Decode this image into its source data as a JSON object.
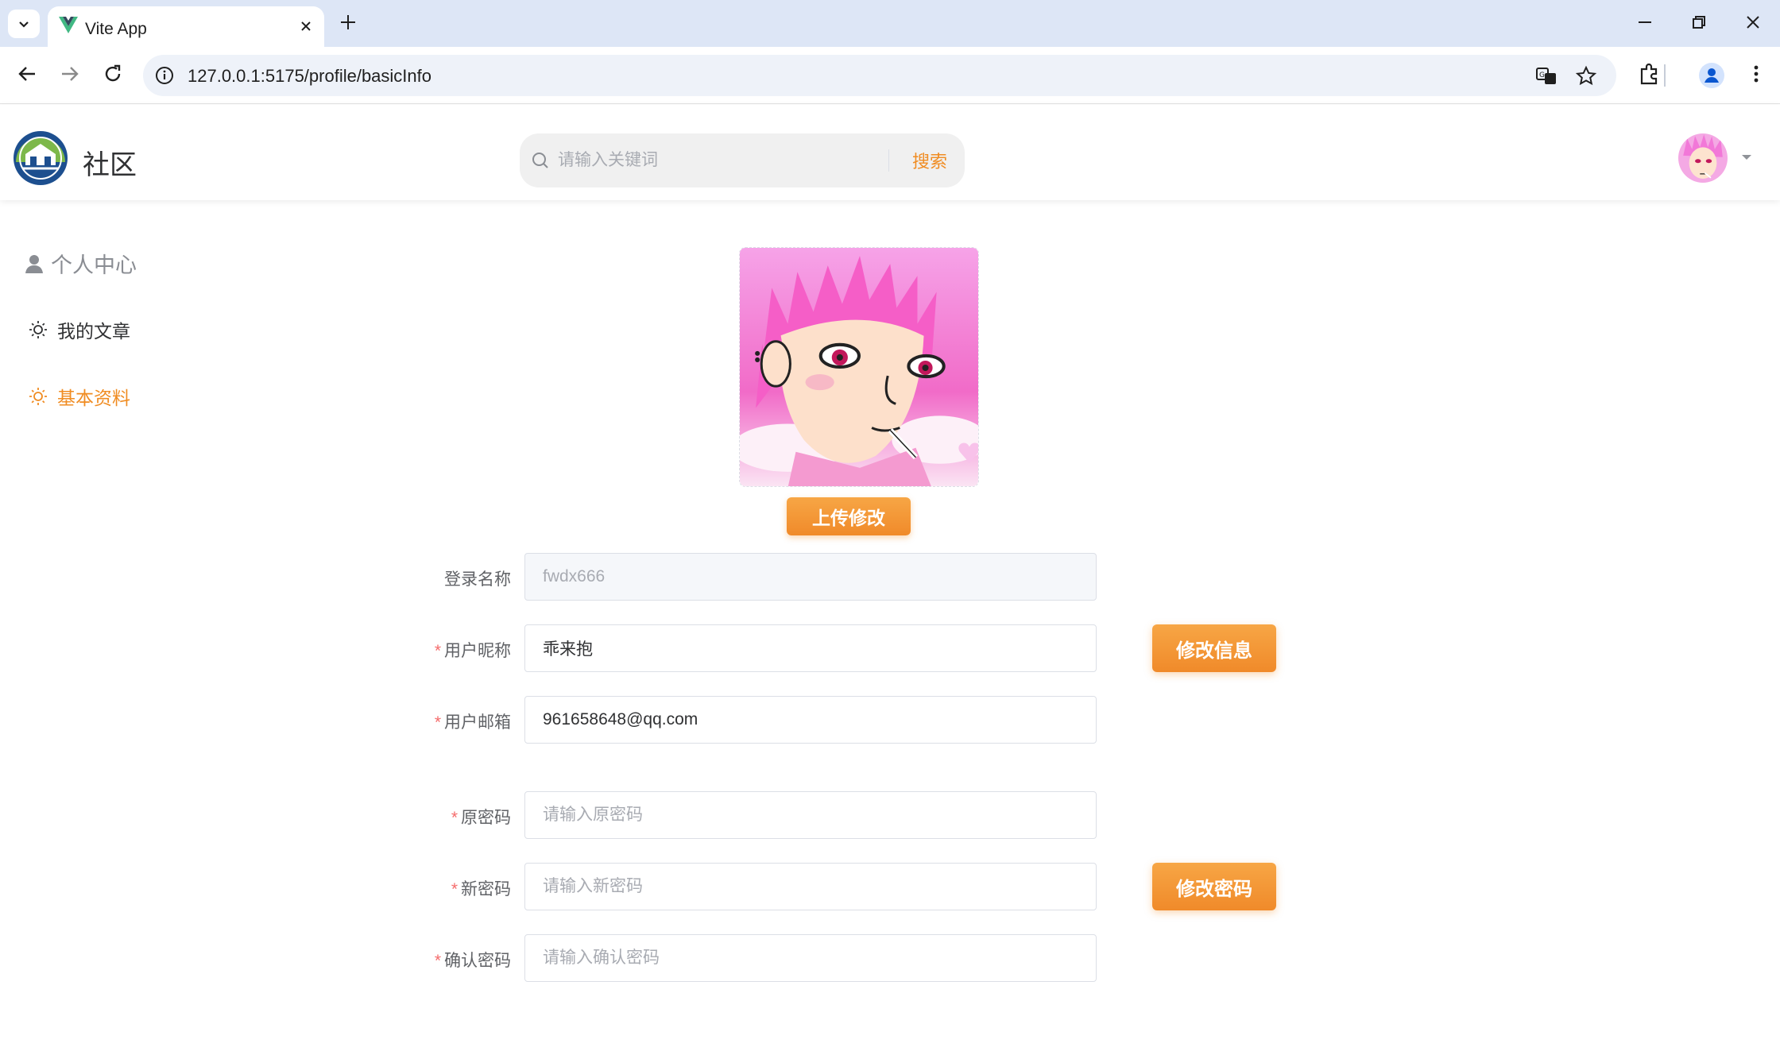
{
  "browser": {
    "tab_title": "Vite App",
    "url": "127.0.0.1:5175/profile/basicInfo"
  },
  "header": {
    "brand": "社区",
    "search_placeholder": "请输入关键词",
    "search_button": "搜索"
  },
  "sidebar": {
    "heading": "个人中心",
    "items": [
      {
        "label": "我的文章",
        "active": false
      },
      {
        "label": "基本资料",
        "active": true
      }
    ]
  },
  "profile": {
    "upload_button": "上传修改",
    "fields": {
      "login_name": {
        "label": "登录名称",
        "value": "fwdx666"
      },
      "nickname": {
        "label": "用户昵称",
        "value": "乖来抱"
      },
      "email": {
        "label": "用户邮箱",
        "value": "961658648@qq.com"
      },
      "old_password": {
        "label": "原密码",
        "placeholder": "请输入原密码"
      },
      "new_password": {
        "label": "新密码",
        "placeholder": "请输入新密码"
      },
      "confirm_password": {
        "label": "确认密码",
        "placeholder": "请输入确认密码"
      }
    },
    "required_mark": "*",
    "update_info_button": "修改信息",
    "update_password_button": "修改密码"
  },
  "colors": {
    "accent": "#f08c22",
    "required": "#f56c6c",
    "tabbar_bg": "#dde6f6"
  },
  "icons": [
    "tab-search-icon",
    "vue-logo-icon",
    "close-icon",
    "plus-icon",
    "minimize-icon",
    "restore-icon",
    "back-icon",
    "forward-icon",
    "reload-icon",
    "info-icon",
    "translate-icon",
    "star-icon",
    "extensions-icon",
    "profile-icon",
    "more-icon",
    "search-icon",
    "caret-down-icon",
    "user-icon",
    "sun-icon"
  ]
}
